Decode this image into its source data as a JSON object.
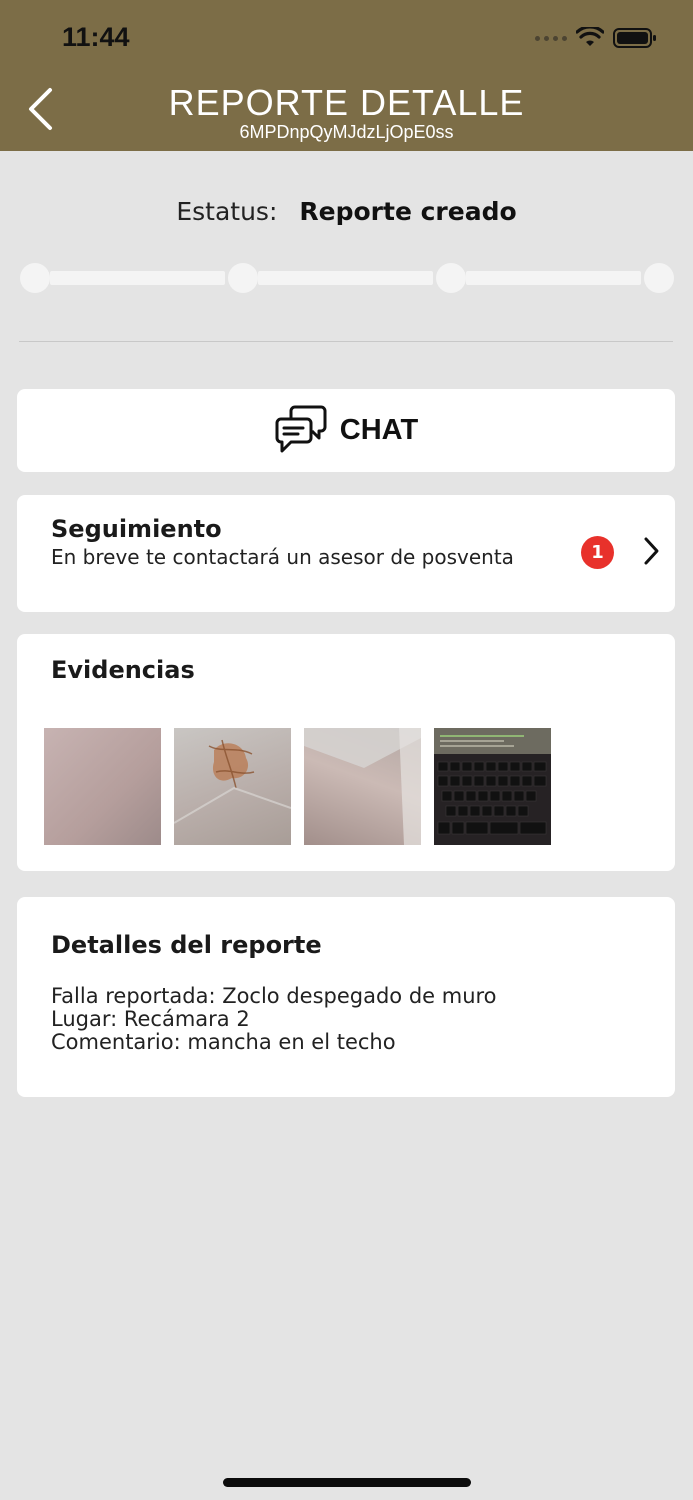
{
  "status_bar": {
    "time": "11:44"
  },
  "header": {
    "title": "REPORTE DETALLE",
    "subtitle": "6MPDnpQyMJdzLjOpE0ss",
    "color": "#7c6d47"
  },
  "status": {
    "label": "Estatus:",
    "value": "Reporte creado",
    "progress_steps": 4,
    "completed_steps": 0
  },
  "chat": {
    "label": "CHAT"
  },
  "seguimiento": {
    "title": "Seguimiento",
    "text": "En breve te contactará un asesor de posventa",
    "badge": "1",
    "badge_color": "#e8312b"
  },
  "evidencias": {
    "title": "Evidencias",
    "images": [
      {
        "name": "evidence-photo-wall"
      },
      {
        "name": "evidence-photo-stain"
      },
      {
        "name": "evidence-photo-corner"
      },
      {
        "name": "evidence-photo-keyboard"
      }
    ]
  },
  "detalles": {
    "title": "Detalles del reporte",
    "falla": "Falla reportada: Zoclo despegado de muro",
    "lugar": "Lugar: Recámara 2",
    "comentario": "Comentario: mancha en el techo"
  }
}
